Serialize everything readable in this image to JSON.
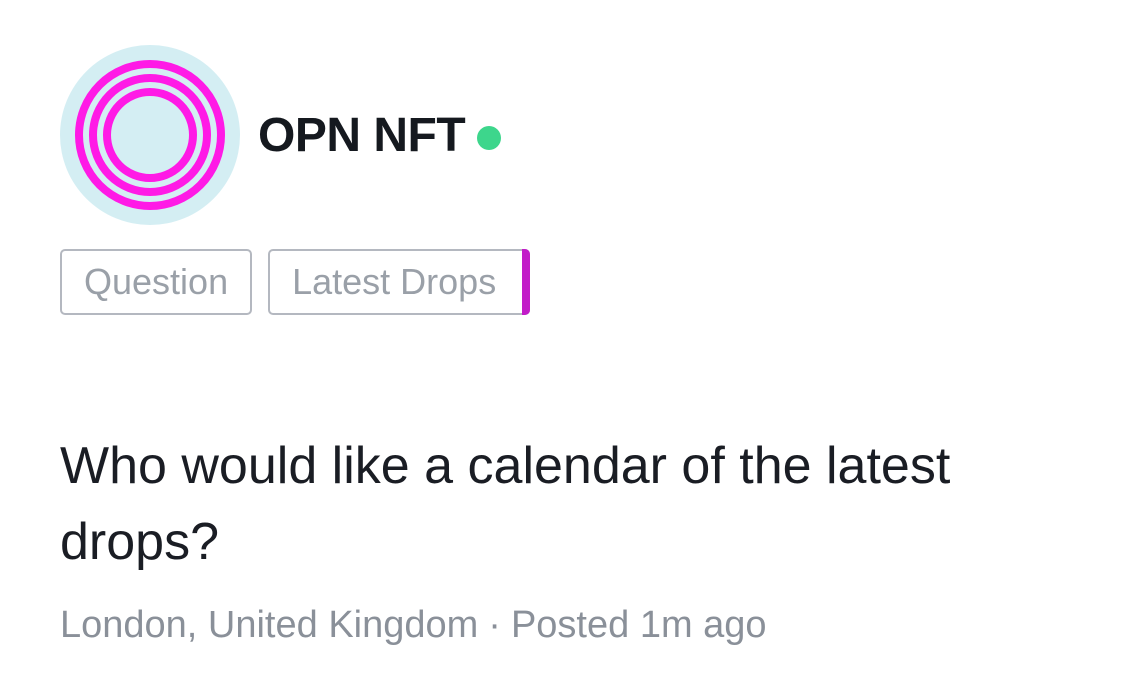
{
  "profile": {
    "name": "OPN NFT",
    "online_status_icon": "online-dot-icon",
    "avatar_icon": "concentric-rings-logo",
    "avatar_bg_color": "#d4eef3",
    "avatar_ring_color": "#ff1ae6",
    "online_color": "#3dd68c"
  },
  "tags": [
    {
      "label": "Question",
      "selected": false
    },
    {
      "label": "Latest Drops",
      "selected": true,
      "accent_color": "#c21cc8"
    }
  ],
  "post": {
    "question": "Who would like a calendar of the latest drops?",
    "location": "London, United Kingdom",
    "separator": "·",
    "posted": "Posted 1m ago"
  }
}
